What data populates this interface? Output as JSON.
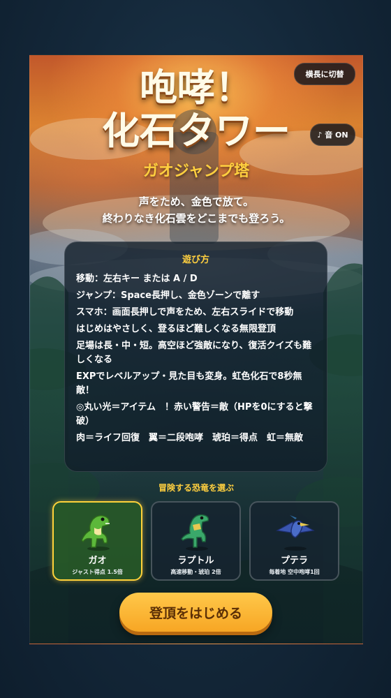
{
  "buttons": {
    "landscape_toggle": "横長に切替",
    "sound_toggle": "♪ 音 ON",
    "start": "登頂をはじめる"
  },
  "title": {
    "line1": "咆哮！",
    "line2": "化石タワー",
    "subtitle": "ガオジャンプ塔"
  },
  "tagline": {
    "line1": "声をため、金色で放て。",
    "line2": "終わりなき化石雲をどこまでも登ろう。"
  },
  "howto": {
    "title": "遊び方",
    "lines": [
      "移動：左右キー または A / D",
      "ジャンプ：Space長押し、金色ゾーンで離す",
      "スマホ：画面長押しで声をため、左右スライドで移動",
      "はじめはやさしく、登るほど難しくなる無限登頂",
      "足場は長・中・短。高空ほど強敵になり、復活クイズも難しくなる",
      "EXPでレベルアップ・見た目も変身。虹色化石で8秒無敵！",
      "◎丸い光＝アイテム　！赤い警告＝敵（HPを0にすると撃破）",
      "肉＝ライフ回復　翼＝二段咆哮　琥珀＝得点　虹＝無敵"
    ]
  },
  "dino_select": {
    "label": "冒険する恐竜を選ぶ",
    "selected": "ガオ",
    "options": [
      {
        "name": "ガオ",
        "desc": "ジャスト得点 1.5倍",
        "icon": "t-rex-icon",
        "color": "#5cb83a"
      },
      {
        "name": "ラプトル",
        "desc": "高速移動・琥珀 2倍",
        "icon": "raptor-icon",
        "color": "#3aa86a"
      },
      {
        "name": "プテラ",
        "desc": "毎着地 空中咆哮1回",
        "icon": "pterodactyl-icon",
        "color": "#4a6cc8"
      }
    ]
  },
  "colors": {
    "accent_gold": "#ffcf3f",
    "start_button": "#f7a624",
    "selected_border": "#ffd23a"
  }
}
